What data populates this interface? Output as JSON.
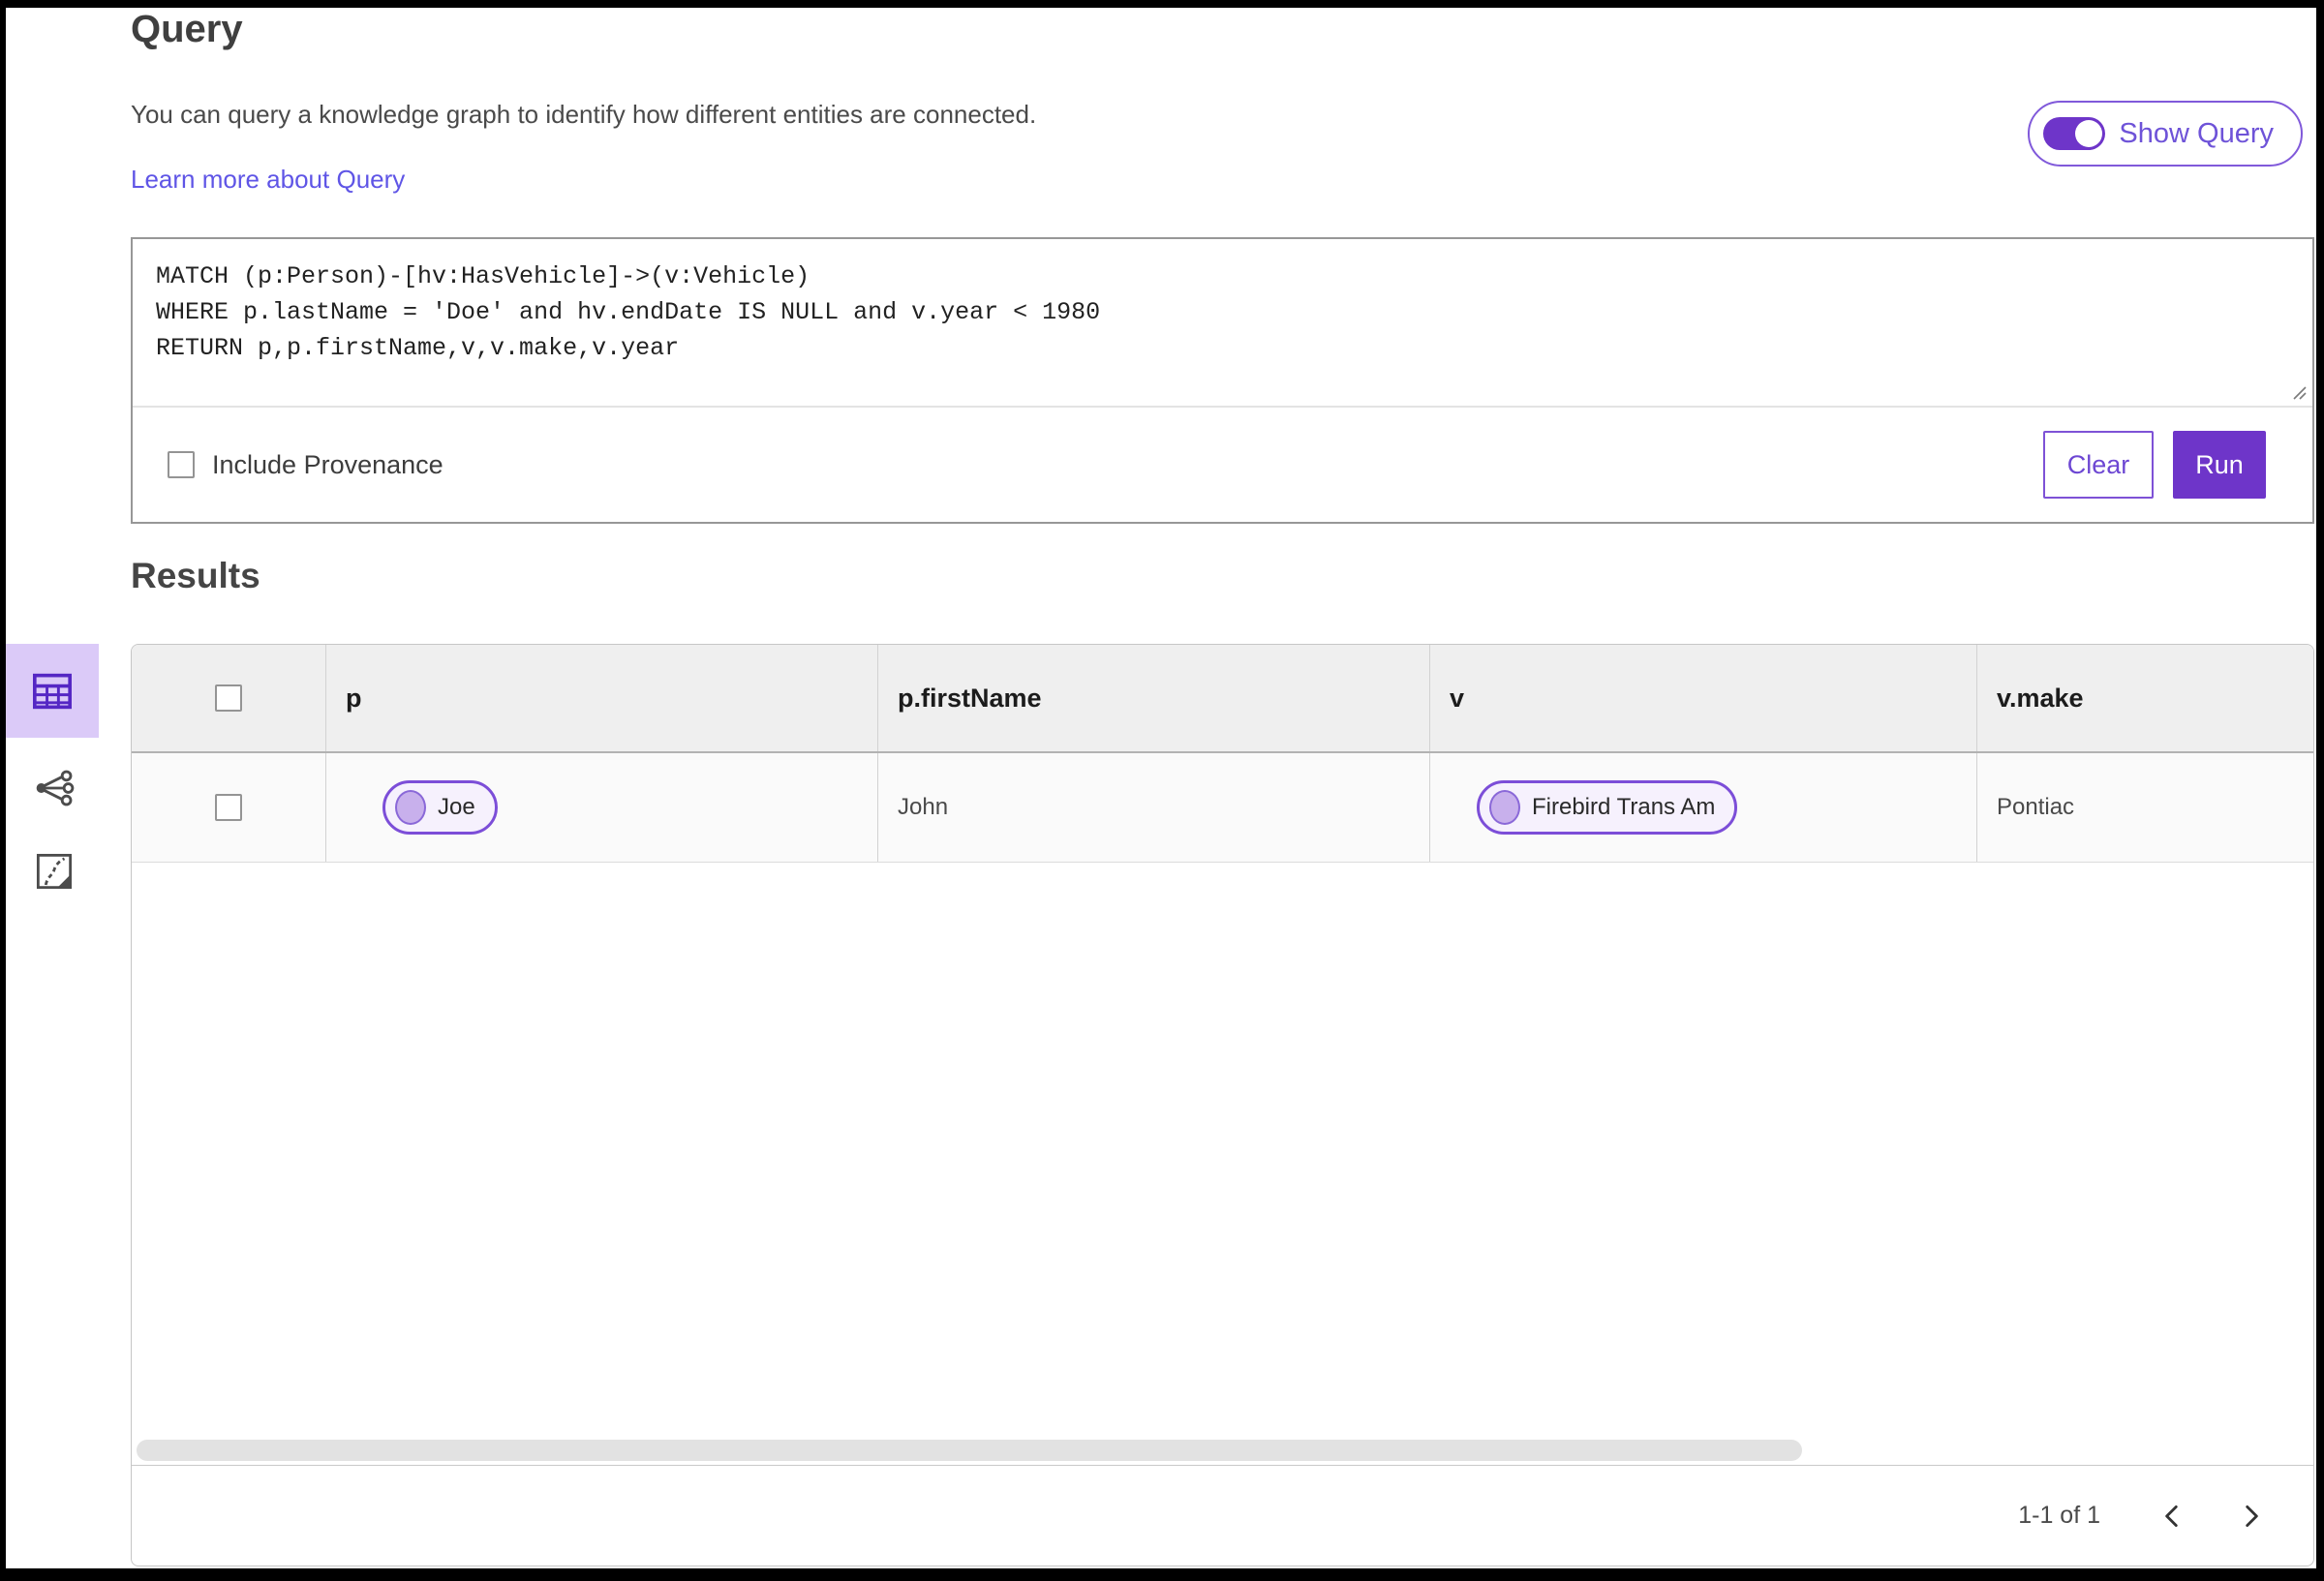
{
  "query": {
    "title": "Query",
    "description": "You can query a knowledge graph to identify how different entities are connected.",
    "learn_more": "Learn more about Query",
    "show_query": "Show Query",
    "code": "MATCH (p:Person)-[hv:HasVehicle]->(v:Vehicle)\nWHERE p.lastName = 'Doe' and hv.endDate IS NULL and v.year < 1980\nRETURN p,p.firstName,v,v.make,v.year",
    "include_provenance": "Include Provenance",
    "clear": "Clear",
    "run": "Run"
  },
  "results": {
    "title": "Results",
    "views": {
      "selected": "table-view",
      "icons": [
        "table-view-icon",
        "network-view-icon",
        "map-view-icon"
      ]
    },
    "table": {
      "columns": [
        "p",
        "p.firstName",
        "v",
        "v.make"
      ],
      "row": {
        "p": "Joe",
        "p_firstName": "John",
        "v": "Firebird Trans Am",
        "v_make": "Pontiac"
      }
    },
    "pagination": {
      "label": "1-1 of 1"
    }
  },
  "colors": {
    "primary_purple": "#6e35c9",
    "link_purple": "#5f55e6",
    "selected_view_bg": "#dbcaf8",
    "pill_border": "#7c4ed8",
    "pill_bg": "#f6f1fd"
  }
}
